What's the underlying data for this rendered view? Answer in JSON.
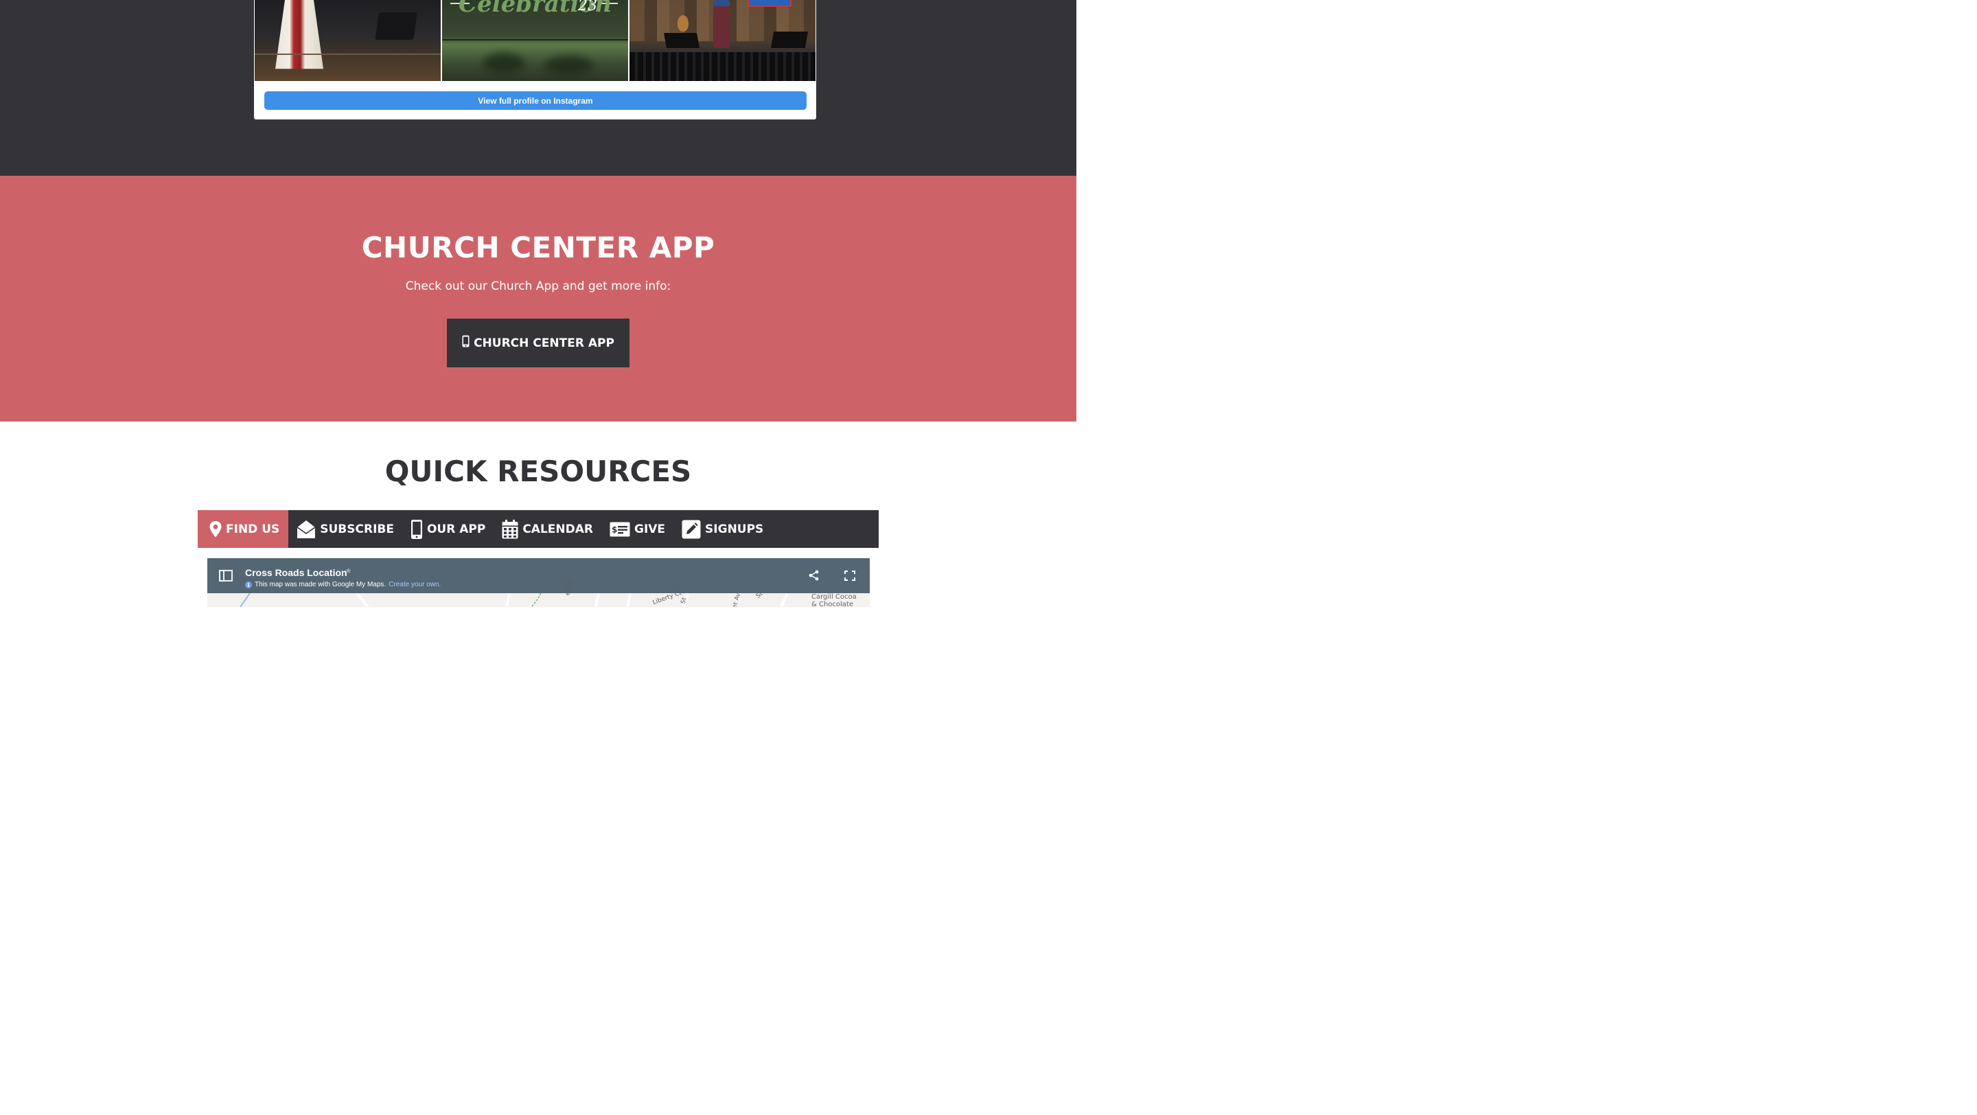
{
  "instagram": {
    "photo_1_alt": "Stage with red and white robe",
    "photo_2_text": "Celebration",
    "photo_2_year": "23",
    "photo_3_alt": "Speaker on wooden stage",
    "view_profile_label": "View full profile on Instagram"
  },
  "app_section": {
    "title": "CHURCH CENTER APP",
    "subtitle": "Check out our Church App and get more info:",
    "button_label": "CHURCH CENTER APP",
    "button_icon": "mobile-phone-icon"
  },
  "resources": {
    "title": "QUICK RESOURCES",
    "tabs": [
      {
        "label": "FIND US",
        "icon": "map-marker-icon",
        "active": true
      },
      {
        "label": "SUBSCRIBE",
        "icon": "envelope-open-icon",
        "active": false
      },
      {
        "label": "OUR APP",
        "icon": "mobile-phone-icon",
        "active": false
      },
      {
        "label": "CALENDAR",
        "icon": "calendar-icon",
        "active": false
      },
      {
        "label": "GIVE",
        "icon": "money-check-icon",
        "active": false
      },
      {
        "label": "SIGNUPS",
        "icon": "edit-icon",
        "active": false
      }
    ]
  },
  "map": {
    "title": "Cross Roads Location",
    "info_text": "This map was made with Google My Maps.",
    "info_link": "Create your own.",
    "streets": [
      "e Cro",
      "Liberty Ct",
      "St",
      "et Av",
      "St"
    ],
    "poi_line_1": "Cargill Cocoa",
    "poi_line_2": "& Chocolate"
  },
  "colors": {
    "dark": "#333338",
    "accent": "#cd6368",
    "instagram_button": "#3d8fe8",
    "map_header": "#546673"
  }
}
